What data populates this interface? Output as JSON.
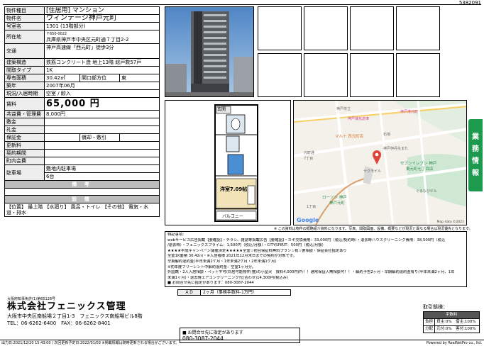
{
  "doc_id": "5382091",
  "property": {
    "type_label": "物件種目",
    "type_value": "[住居用] マンション",
    "name_label": "物件名",
    "name_value": "ウィンテージ神戸元町",
    "room_label": "号室名",
    "room_value": "1301 (13階部分)",
    "address_label": "所在地",
    "postal": "〒650-0022",
    "address_value": "兵庫県神戸市中央区元町通７丁目2-2",
    "access_label": "交通",
    "access_value": "神戸高速線「西元町」徒歩3分",
    "structure_label": "建築構造",
    "structure_value": "鉄筋コンクリート造 地上13階 総戸数57戸",
    "layout_label": "間取タイプ",
    "layout_value": "1K",
    "area_label": "専有面積",
    "area_value": "30.42㎡",
    "window_label": "開口部方位",
    "window_value": "東",
    "built_label": "築年",
    "built_value": "2007年06月",
    "status_label": "現況/入居時期",
    "status_value": "空室 / 即入",
    "rent_label": "賃料",
    "rent_value": "65,000 円",
    "fee_label": "共益費・管理費",
    "fee_value": "8,000円",
    "deposit_label": "敷金",
    "key_label": "礼金",
    "guarantee_label": "保証金",
    "amort_label": "償却・敷引",
    "renew_label": "更新料",
    "term_label": "契約期間",
    "assoc_label": "町内会費",
    "parking_label": "駐車場",
    "parking_value1": "敷地内駐車場",
    "parking_value2": "6台",
    "biko_band": "備 考",
    "setsubi_band": "設 備",
    "setsubi_value": "【位置】 最上階 【水廻り】 風呂・トイレ 【その他】 電気・水道・排水"
  },
  "floorplan": {
    "genkan": "玄関",
    "room": "洋室7.09帖",
    "balcony": "バルコニー"
  },
  "map": {
    "labels": [
      "神戸港元町",
      "神戸市立",
      "神戸煉瓦倉庫",
      "マルナ 西元町店",
      "石地",
      "元町通",
      "7丁目",
      "神戸伊丹生まれ",
      "セブンイレブン 神戸",
      "東元町七丁目店",
      "ぐるなびビル",
      "1丁目",
      "ローソン 神戸",
      "神戸元町",
      "ヤクモビル"
    ],
    "google": "Google",
    "credit": "Map data ©2021"
  },
  "notice_top": "※ この資料は物件の概略紹介資料になります。写真、間取図面、設備、概要などが現況と異なる場合は現況優先となります。",
  "remarks": {
    "title": "特記事項:",
    "lines": [
      "webサービス広告掲載【要確認】・チラシ、雑誌等掲載広告【要確認】・カギ交換費用：33,000円（税込/契約時）・退去時ハウスクリーニング費用：38,500円（税込",
      "/退去時）・フェニックスプライム：1,500円（税込/月額）・CITYSPIRIT：500円（税込/月額）",
      "★★★★平成キャンペーン開催決定★★★★★全室☆初回保証料無料プラン☆有☆要相談・保証会社指定あり",
      "全室1K面積 30.42㎡・※入居者様 2021年12月末日までの契約が対象です。",
      "早期解約違約金(半年未満2ケ月・1年未満2ケ月・2年未満1ケ月)",
      "※初年度フリーレント中解約違約金：空室1ヶ月分。",
      "外国籍・2人入居相談・ペット不可(同居可能物件(猫)の小型犬　資料4,000円(P)！！通常保証人無相談可！！・解約予告2ヶ月・早期解約違約金有り(半年未満2ヶ月、1年",
      "未満1ヶ月)・退去時エアコンクリーニング代(合わせ)14,300円(税込み)",
      "■ お問合せ先に指定があります：080-3087-2044"
    ]
  },
  "ad": {
    "label": "ＡＤ",
    "value": "2ヶ月（事務手数料-1万円）"
  },
  "company": {
    "license": "大阪府知事免許(1)第65128号",
    "name": "株式会社フェニックス管理",
    "address": "大阪市中央区南船場２丁目1-3　フェニックス南船場ビル8階",
    "tel_fax": "TEL：06-6262-6400　FAX：06-6262-8401"
  },
  "torihiki": {
    "title": "取引態様：",
    "header": "手数料",
    "row1_k": "負担",
    "row1_v": "貸主:0%　借主:100%",
    "row2_k": "分配",
    "row2_v": "元付:0%　客付:100%"
  },
  "boxnote": {
    "line1": "■ お問合せ先に指定があります",
    "tel": "080-3087-2044"
  },
  "footer": {
    "left": "出力日:2021/12/20 15:43:00 / 次回更新予定日:2022/01/03 ※掲載情報は随時更新される場合がございます。",
    "right": "Powered by RealNetPro co., ltd."
  },
  "sidetab": [
    "業",
    "務",
    "情",
    "報"
  ],
  "colors": {
    "accent_green": "#1e9a4e",
    "band_gray": "#bcbcbc"
  }
}
